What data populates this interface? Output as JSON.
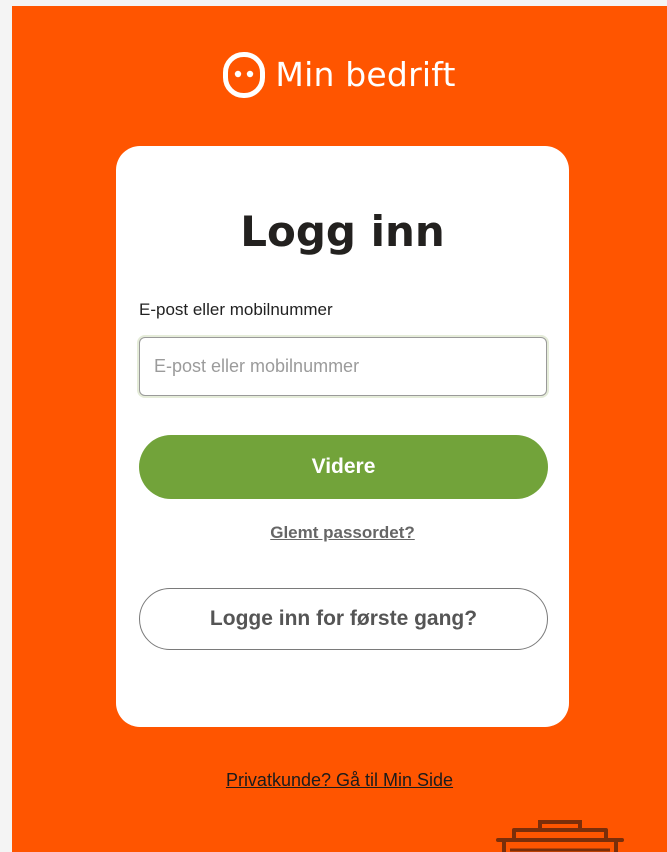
{
  "brand": {
    "name": "Min bedrift",
    "icon": "smiley-face-icon"
  },
  "login": {
    "title": "Logg inn",
    "field_label": "E-post eller mobilnummer",
    "field_placeholder": "E-post eller mobilnummer",
    "field_value": "",
    "submit_label": "Videre",
    "forgot_label": "Glemt passordet?",
    "first_time_label": "Logge inn for første gang?"
  },
  "footer": {
    "private_link_label": "Privatkunde? Gå til Min Side"
  },
  "colors": {
    "background": "#ff5500",
    "primary_button": "#72a33a",
    "card": "#ffffff",
    "text": "#23211f"
  }
}
